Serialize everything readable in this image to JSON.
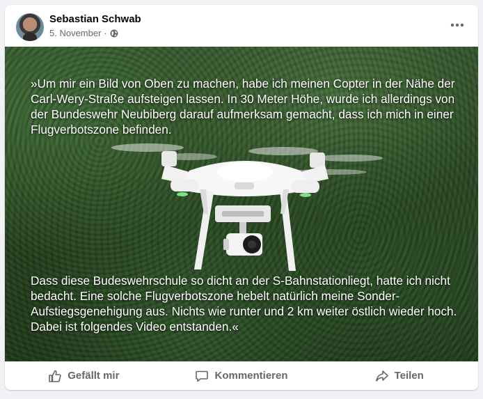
{
  "post": {
    "author": "Sebastian Schwab",
    "date": "5. November",
    "separator": "·",
    "audience_icon": "globe-icon",
    "more_icon": "more-options-icon"
  },
  "media": {
    "quote_top": "»Um mir ein Bild von Oben zu machen, habe ich meinen Copter in der Nähe der Carl-Wery-Straße aufsteigen lassen. In 30 Meter Höhe, wurde ich allerdings von der Bundeswehr Neubiberg darauf aufmerksam gemacht, dass ich mich in einer Flugverbotszone befinden.",
    "quote_bottom": "Dass diese Budeswehrschule so dicht an der S-Bahnstationliegt, hatte ich nicht bedacht. Eine solche Flugverbotszone hebelt natürlich meine Sonder-Aufstiegsgenehigung aus. Nichts wie runter und 2 km weiter östlich wieder hoch. Dabei ist folgendes Video entstanden.«"
  },
  "actions": [
    {
      "label": "Gefällt mir",
      "icon": "like-icon"
    },
    {
      "label": "Kommentieren",
      "icon": "comment-icon"
    },
    {
      "label": "Teilen",
      "icon": "share-icon"
    }
  ]
}
